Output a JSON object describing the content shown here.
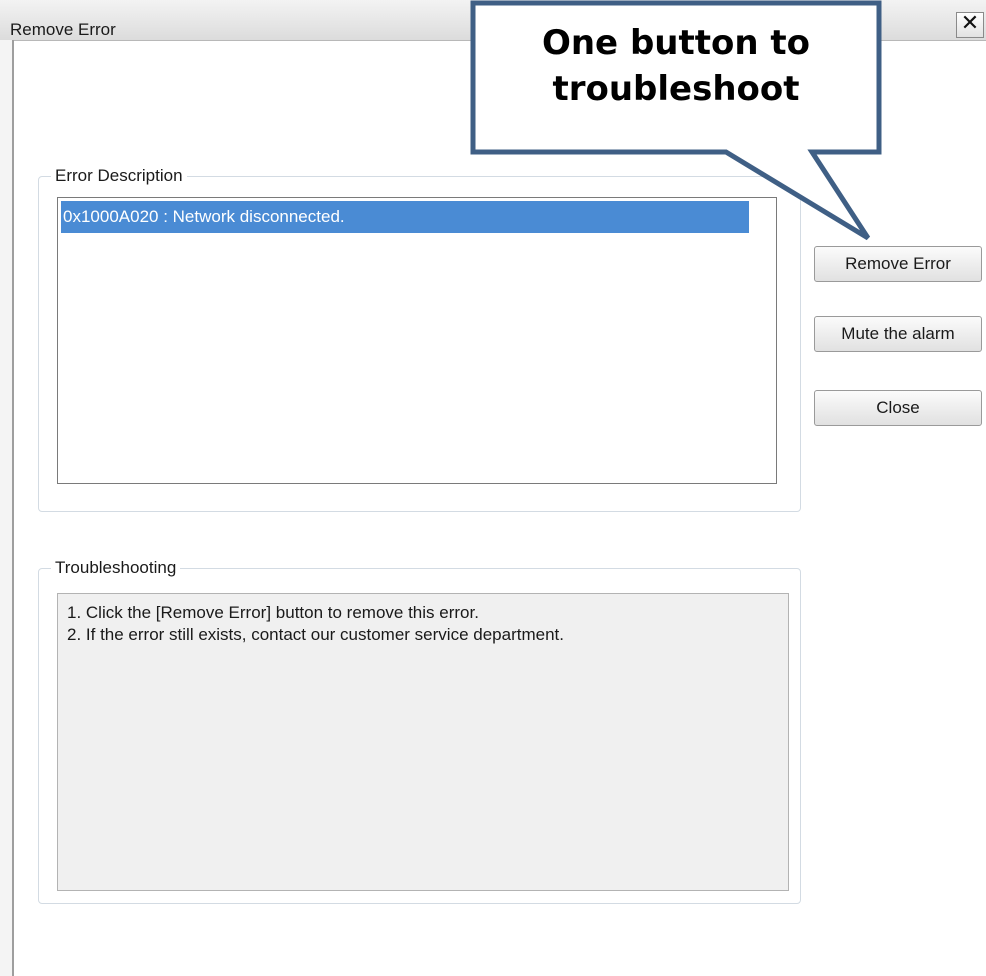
{
  "window": {
    "title": "Remove Error",
    "close_glyph": "✕"
  },
  "error_description": {
    "legend": "Error Description",
    "items": [
      {
        "text": "0x1000A020 : Network disconnected.",
        "selected": true
      }
    ]
  },
  "troubleshooting": {
    "legend": "Troubleshooting",
    "lines": [
      "1. Click the [Remove Error] button to remove this error.",
      "2. If the error still exists, contact our customer service department."
    ]
  },
  "buttons": {
    "remove_error": "Remove Error",
    "mute_alarm": "Mute the alarm",
    "close": "Close"
  },
  "callout": {
    "line1": "One button to",
    "line2": "troubleshoot",
    "border_color": "#3f5f85"
  },
  "colors": {
    "selection": "#4a8bd4"
  }
}
